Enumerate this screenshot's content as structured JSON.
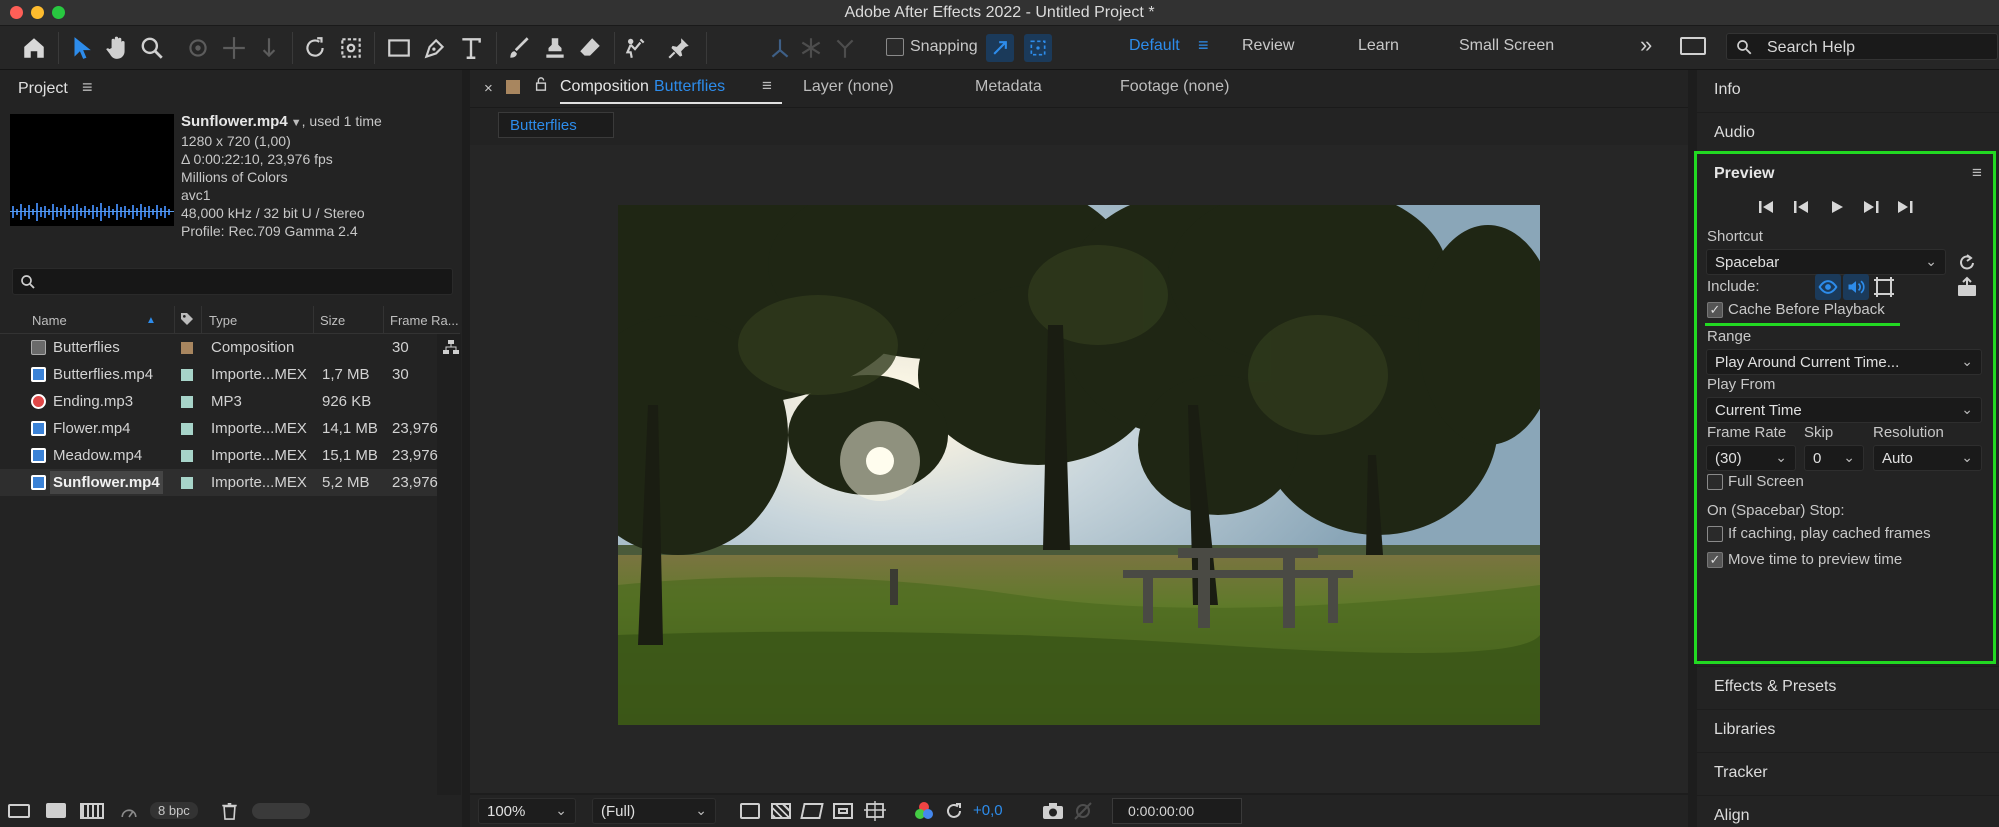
{
  "app": {
    "title": "Adobe After Effects 2022 - Untitled Project *"
  },
  "toolbar": {
    "snapping_label": "Snapping",
    "workspaces": [
      "Default",
      "Review",
      "Learn",
      "Small Screen"
    ],
    "search_placeholder": "Search Help",
    "more": "»"
  },
  "project": {
    "panel_title": "Project",
    "selected": {
      "name": "Sunflower.mp4",
      "used": ", used 1 time",
      "lines": [
        "1280 x 720 (1,00)",
        "Δ 0:00:22:10, 23,976 fps",
        "Millions of Colors",
        "avc1",
        "48,000 kHz / 32 bit U / Stereo",
        "Profile: Rec.709 Gamma 2.4"
      ]
    },
    "columns": {
      "name": "Name",
      "type": "Type",
      "size": "Size",
      "frame_rate": "Frame Ra..."
    },
    "items": [
      {
        "name": "Butterflies",
        "type": "Composition",
        "size": "",
        "fps": "30",
        "icon": "composition-icon",
        "label_color": "#a8865f",
        "file_color": "#6a6a6a"
      },
      {
        "name": "Butterflies.mp4",
        "type": "Importe...MEX",
        "size": "1,7 MB",
        "fps": "30",
        "icon": "footage-icon",
        "label_color": "#a7d4c9",
        "file_color": "#3b82d6"
      },
      {
        "name": "Ending.mp3",
        "type": "MP3",
        "size": "926 KB",
        "fps": "",
        "icon": "audio-icon",
        "label_color": "#a7d4c9",
        "file_color": "#e04848"
      },
      {
        "name": "Flower.mp4",
        "type": "Importe...MEX",
        "size": "14,1 MB",
        "fps": "23,976",
        "icon": "footage-icon",
        "label_color": "#a7d4c9",
        "file_color": "#3b82d6"
      },
      {
        "name": "Meadow.mp4",
        "type": "Importe...MEX",
        "size": "15,1 MB",
        "fps": "23,976",
        "icon": "footage-icon",
        "label_color": "#a7d4c9",
        "file_color": "#3b82d6"
      },
      {
        "name": "Sunflower.mp4",
        "type": "Importe...MEX",
        "size": "5,2 MB",
        "fps": "23,976",
        "icon": "footage-icon",
        "label_color": "#a7d4c9",
        "file_color": "#3b82d6"
      }
    ],
    "bpc": "8 bpc"
  },
  "viewer": {
    "tab_composition_prefix": "Composition",
    "tab_composition_name": "Butterflies",
    "tab_layer": "Layer (none)",
    "tab_metadata": "Metadata",
    "tab_footage": "Footage (none)",
    "breadcrumb": "Butterflies",
    "zoom": "100%",
    "resolution": "(Full)",
    "exposure": "+0,0",
    "timecode": "0:00:00:00"
  },
  "right": {
    "info": "Info",
    "audio": "Audio",
    "preview": {
      "title": "Preview",
      "shortcut_label": "Shortcut",
      "shortcut_value": "Spacebar",
      "include_label": "Include:",
      "cache_label": "Cache Before Playback",
      "range_label": "Range",
      "range_value": "Play Around Current Time...",
      "play_from_label": "Play From",
      "play_from_value": "Current Time",
      "frame_rate_label": "Frame Rate",
      "frame_rate_value": "(30)",
      "skip_label": "Skip",
      "skip_value": "0",
      "resolution_label": "Resolution",
      "resolution_value": "Auto",
      "full_screen_label": "Full Screen",
      "stop_label": "On (Spacebar) Stop:",
      "if_caching_label": "If caching, play cached frames",
      "move_time_label": "Move time to preview time"
    },
    "effects": "Effects & Presets",
    "libraries": "Libraries",
    "tracker": "Tracker",
    "align": "Align"
  },
  "colors": {
    "accent": "#2d8ceb",
    "highlight": "#22d922"
  }
}
